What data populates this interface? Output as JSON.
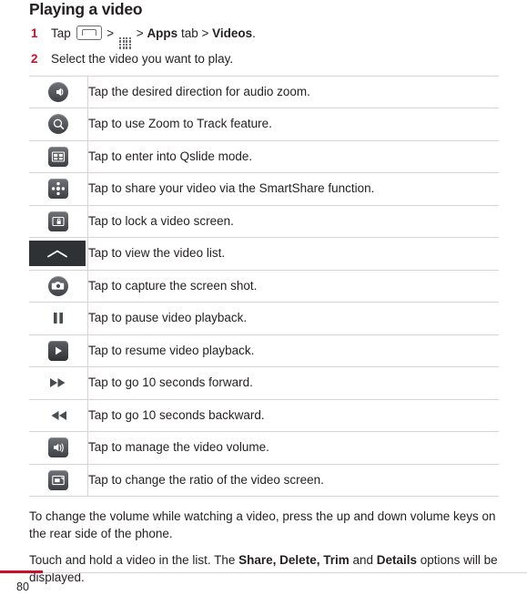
{
  "document": {
    "title": "Playing a video",
    "page_number": "80",
    "accent_color": "#c8102e"
  },
  "steps": [
    {
      "number": "1",
      "parts": [
        {
          "type": "text",
          "value": "Tap "
        },
        {
          "type": "icon",
          "value": "home-key-icon"
        },
        {
          "type": "text",
          "value": " > "
        },
        {
          "type": "icon",
          "value": "apps-grid-icon"
        },
        {
          "type": "text",
          "value": " > "
        },
        {
          "type": "bold",
          "value": "Apps"
        },
        {
          "type": "text",
          "value": " tab > "
        },
        {
          "type": "bold",
          "value": "Videos"
        },
        {
          "type": "text",
          "value": "."
        }
      ],
      "plain": "Tap  >  > Apps tab > Videos."
    },
    {
      "number": "2",
      "parts": [
        {
          "type": "text",
          "value": "Select the video you want to play."
        }
      ],
      "plain": "Select the video you want to play."
    }
  ],
  "icon_table": {
    "rows": [
      {
        "icon": "audio-zoom-icon",
        "description": "Tap the desired direction for audio zoom."
      },
      {
        "icon": "zoom-to-track-icon",
        "description": "Tap to use Zoom to Track feature."
      },
      {
        "icon": "qslide-icon",
        "description": "Tap to enter into Qslide mode."
      },
      {
        "icon": "smartshare-icon",
        "description": "Tap to share your video via the SmartShare function."
      },
      {
        "icon": "screen-lock-icon",
        "description": "Tap to lock a video screen."
      },
      {
        "icon": "video-list-chevron-icon",
        "description": "Tap to view the video list."
      },
      {
        "icon": "screen-capture-icon",
        "description": "Tap to capture the screen shot."
      },
      {
        "icon": "pause-icon",
        "description": "Tap to pause video playback."
      },
      {
        "icon": "play-icon",
        "description": "Tap to resume video playback."
      },
      {
        "icon": "fast-forward-icon",
        "description": "Tap to go 10 seconds forward."
      },
      {
        "icon": "rewind-icon",
        "description": "Tap to go 10 seconds backward."
      },
      {
        "icon": "volume-icon",
        "description": "Tap to manage the video volume."
      },
      {
        "icon": "aspect-ratio-icon",
        "description": "Tap to change the ratio of the video screen."
      }
    ]
  },
  "paragraphs": {
    "volume_note": "To change the volume while watching a video, press the up and down volume keys on the rear side of the phone.",
    "touch_hold": {
      "lead": "Touch and hold a video in the list. The ",
      "bold1": "Share, Delete, Trim",
      "mid": " and ",
      "bold2": "Details",
      "tail": " options will be displayed."
    }
  }
}
